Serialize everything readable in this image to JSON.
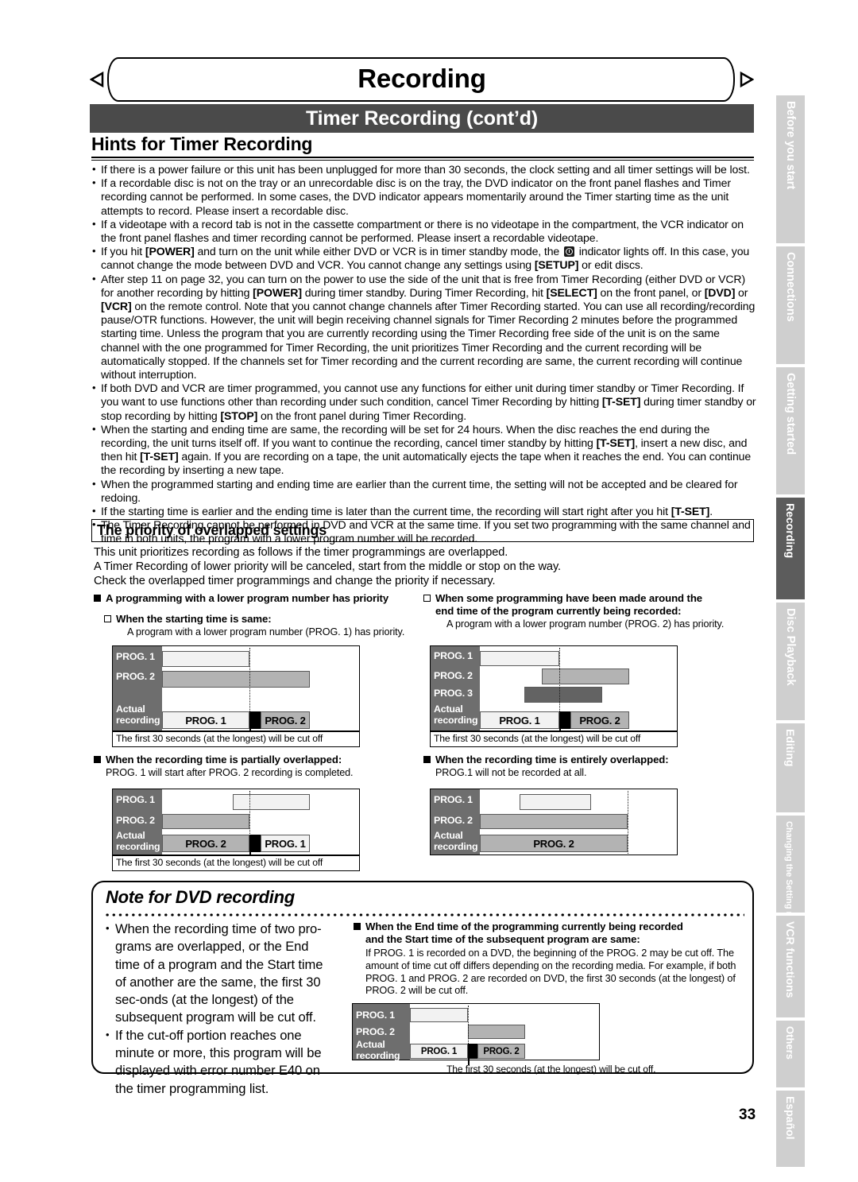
{
  "banner": {
    "title": "Recording"
  },
  "title_bar": {
    "text": "Timer Recording (cont’d)"
  },
  "section": {
    "heading": "Hints for Timer Recording"
  },
  "hints": [
    "If there is a power failure or this unit has been unplugged for more than 30 seconds, the clock setting and all timer settings will be lost.",
    "If a recordable disc is not on the tray or an unrecordable disc is on the tray, the DVD indicator on the front panel flashes and Timer recording cannot be performed.  In some cases, the DVD indicator appears momentarily around the Timer starting time as the unit attempts to record.  Please insert a recordable disc.",
    "If a videotape with a record tab is not in the cassette compartment or there is no videotape in the compartment, the VCR indicator on the front panel flashes and timer recording cannot be performed.  Please insert a recordable videotape.",
    "If you hit [POWER] and turn on the unit while either DVD or VCR is in timer standby mode, the  ⏰  indicator lights off. In this case, you cannot change the mode between DVD and VCR. You cannot change any settings using [SETUP] or edit discs.",
    "After step 11 on page 32, you can turn on the power to use the side of the unit that is free from Timer Recording (either DVD or VCR) for another recording by hitting [POWER] during timer standby.  During Timer Recording, hit [SELECT] on the front panel, or [DVD] or [VCR] on the remote control.  Note that you cannot change channels after Timer Recording started. You can use all recording/recording pause/OTR functions. However, the unit will begin receiving channel signals for Timer Recording 2 minutes before the programmed starting time. Unless the program that you are currently recording using the Timer Recording free side of the unit is on the same channel with the one programmed for Timer Recording, the unit prioritizes Timer Recording and the current recording will be automatically stopped.  If the channels set for Timer recording and the current recording are same, the current recording will continue without interruption.",
    "If both DVD and VCR are timer programmed, you cannot use any functions for either unit during timer standby or Timer Recording.  If you want to use functions other than recording under such condition, cancel Timer Recording by hitting [T-SET] during timer standby or stop recording by hitting [STOP] on the front panel during Timer Recording.",
    "When the starting and ending time are same, the recording will be set for 24 hours.  When the disc reaches the end during the recording, the unit turns itself off.  If you want to continue the recording, cancel timer standby by hitting [T-SET], insert a new disc, and then hit [T-SET] again.  If you are recording on a tape, the unit automatically ejects the tape when it reaches the end. You can continue the recording by inserting a new tape.",
    "When the programmed starting and ending time are earlier than the current time, the setting will not be accepted and be cleared for redoing.",
    "If the starting time is earlier and the ending time is later than the current time, the recording will start right after you hit [T-SET].",
    "The Timer Recording cannot be performed in DVD and VCR at the same time. If you set two programming with the same channel and time in both units, the program with a lower program number will be recorded."
  ],
  "priority": {
    "heading": "The priority of overlapped settings",
    "intro_lines": [
      "This unit prioritizes recording as follows if the timer programmings are overlapped.",
      "A Timer Recording of lower priority will be canceled, start from the middle or stop on the way.",
      "Check the overlapped timer programmings and change the priority if necessary."
    ]
  },
  "cases": {
    "left_top": {
      "head": "A programming with a lower program number has priority",
      "sub_head": "When the starting time is same:",
      "sub_text": "A program with a lower program number (PROG. 1) has priority."
    },
    "right_top": {
      "head_line1": "When some programming have been made around the",
      "head_line2": "end time of the program currently being recorded:",
      "sub_text": "A program with a lower program number (PROG. 2) has priority."
    },
    "left_bottom": {
      "head": "When the recording time is partially overlapped:",
      "sub_text": "PROG. 1 will start after PROG. 2 recording is completed."
    },
    "right_bottom": {
      "head": "When the recording time is entirely overlapped:",
      "sub_text": "PROG.1 will not be recorded at all."
    }
  },
  "diagram_labels": {
    "prog1": "PROG. 1",
    "prog2": "PROG. 2",
    "prog3": "PROG. 3",
    "actual": "Actual\nrecording"
  },
  "captions": {
    "cut_off": "The first 30 seconds (at the longest) will be cut off",
    "cut_off_period": "The first 30 seconds (at the longest) will be cut off."
  },
  "chart_data": [
    {
      "type": "bar",
      "id": "diagram-1",
      "title": "When the starting time is same",
      "rows": [
        "PROG. 1",
        "PROG. 2",
        "Actual recording"
      ],
      "bars": [
        {
          "row": "PROG. 1",
          "start": 0.0,
          "end": 0.69,
          "shade": "light"
        },
        {
          "row": "PROG. 2",
          "start": 0.0,
          "end": 1.0,
          "shade": "medium"
        },
        {
          "row": "Actual recording",
          "start": 0.0,
          "end": 0.69,
          "label": "PROG. 1",
          "shade": "light"
        },
        {
          "row": "Actual recording",
          "start": 0.69,
          "end": 0.735,
          "shade": "black"
        },
        {
          "row": "Actual recording",
          "start": 0.735,
          "end": 1.0,
          "label": "PROG. 2",
          "shade": "medium"
        }
      ],
      "marker": 0.69,
      "caption": "The first 30 seconds (at the longest) will be cut off"
    },
    {
      "type": "bar",
      "id": "diagram-2",
      "title": "When some programming have been made around the end time of the program currently being recorded",
      "rows": [
        "PROG. 1",
        "PROG. 2",
        "PROG. 3",
        "Actual recording"
      ],
      "bars": [
        {
          "row": "PROG. 1",
          "start": 0.0,
          "end": 0.63,
          "shade": "light"
        },
        {
          "row": "PROG. 2",
          "start": 0.49,
          "end": 1.0,
          "shade": "medium"
        },
        {
          "row": "PROG. 3",
          "start": 0.355,
          "end": 0.865,
          "shade": "dark"
        },
        {
          "row": "Actual recording",
          "start": 0.0,
          "end": 0.63,
          "label": "PROG. 1",
          "shade": "light"
        },
        {
          "row": "Actual recording",
          "start": 0.63,
          "end": 0.675,
          "shade": "black"
        },
        {
          "row": "Actual recording",
          "start": 0.675,
          "end": 1.0,
          "label": "PROG. 2",
          "shade": "medium"
        }
      ],
      "marker": 0.63,
      "caption": "The first 30 seconds (at the longest) will be cut off"
    },
    {
      "type": "bar",
      "id": "diagram-3",
      "title": "When the recording time is partially overlapped",
      "rows": [
        "PROG. 1",
        "PROG. 2",
        "Actual recording"
      ],
      "bars": [
        {
          "row": "PROG. 1",
          "start": 0.485,
          "end": 1.0,
          "shade": "light"
        },
        {
          "row": "PROG. 2",
          "start": 0.0,
          "end": 0.69,
          "shade": "medium"
        },
        {
          "row": "Actual recording",
          "start": 0.0,
          "end": 0.69,
          "label": "PROG. 2",
          "shade": "medium"
        },
        {
          "row": "Actual recording",
          "start": 0.69,
          "end": 0.735,
          "shade": "black"
        },
        {
          "row": "Actual recording",
          "start": 0.735,
          "end": 1.0,
          "label": "PROG. 1",
          "shade": "light"
        }
      ],
      "marker": 0.69,
      "caption": "The first 30 seconds (at the longest) will be cut off"
    },
    {
      "type": "bar",
      "id": "diagram-4",
      "title": "When the recording time is entirely overlapped",
      "rows": [
        "PROG. 1",
        "PROG. 2",
        "Actual recording"
      ],
      "bars": [
        {
          "row": "PROG. 1",
          "start": 0.28,
          "end": 0.795,
          "shade": "light"
        },
        {
          "row": "PROG. 2",
          "start": 0.0,
          "end": 1.0,
          "shade": "medium"
        },
        {
          "row": "Actual recording",
          "start": 0.0,
          "end": 1.0,
          "label": "PROG. 2",
          "shade": "medium"
        }
      ],
      "marker": 1.0,
      "caption": ""
    },
    {
      "type": "bar",
      "id": "diagram-5",
      "title": "When the End time of the programming currently being recorded and the Start time of the subsequent program are same",
      "rows": [
        "PROG. 1",
        "PROG. 2",
        "Actual recording"
      ],
      "bars": [
        {
          "row": "PROG. 1",
          "start": 0.0,
          "end": 0.355,
          "shade": "light"
        },
        {
          "row": "PROG. 2",
          "start": 0.355,
          "end": 0.705,
          "shade": "medium"
        },
        {
          "row": "Actual recording",
          "start": 0.0,
          "end": 0.355,
          "label": "PROG. 1",
          "shade": "light"
        },
        {
          "row": "Actual recording",
          "start": 0.355,
          "end": 0.4,
          "shade": "black"
        },
        {
          "row": "Actual recording",
          "start": 0.4,
          "end": 0.705,
          "label": "PROG. 2",
          "shade": "medium"
        }
      ],
      "marker": 0.355,
      "caption": "The first 30 seconds (at the longest) will be cut off."
    }
  ],
  "note": {
    "title": "Note for DVD recording",
    "left_bullets": [
      "When the recording time of two pro-grams are overlapped, or the End time of a program and the Start time of another are the same, the first 30 sec-onds (at the longest) of the subsequent program will be cut off.",
      "If the cut-off portion reaches one minute or more, this program will be displayed with error number E40 on the timer programming list."
    ],
    "right_head_line1": "When the End time of the programming currently being recorded",
    "right_head_line2": "and the Start time of the subsequent program are same:",
    "right_body": "If PROG. 1 is recorded on a DVD, the beginning of the PROG. 2 may be cut off. The amount of time cut off differs depending on the recording media. For example, if both PROG. 1 and PROG. 2 are recorded on DVD, the first 30 seconds (at the longest) of PROG. 2 will be cut off."
  },
  "page_number": "33",
  "side_tabs": [
    {
      "label": "Before you start",
      "active": false
    },
    {
      "label": "Connections",
      "active": false
    },
    {
      "label": "Getting started",
      "active": false
    },
    {
      "label": "Recording",
      "active": true
    },
    {
      "label": "Disc Playback",
      "active": false
    },
    {
      "label": "Editing",
      "active": false
    },
    {
      "label": "Changing the Setting menu",
      "active": false
    },
    {
      "label": "VCR functions",
      "active": false
    },
    {
      "label": "Others",
      "active": false
    },
    {
      "label": "Español",
      "active": false
    }
  ]
}
